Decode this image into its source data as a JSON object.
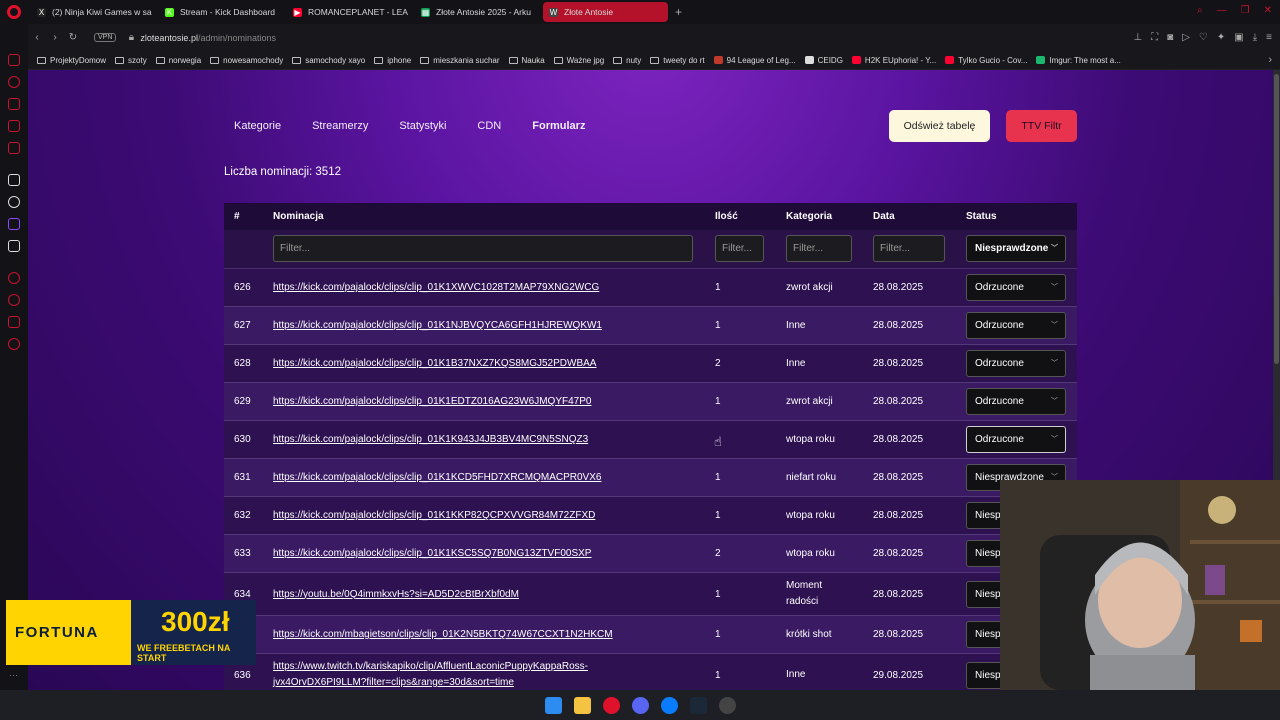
{
  "browser": {
    "tabs": [
      {
        "title": "(2) Ninja Kiwi Games w sa",
        "color": "#222222",
        "glyph": "X"
      },
      {
        "title": "Stream - Kick Dashboard",
        "color": "#53fc18",
        "glyph": "K"
      },
      {
        "title": "ROMANCEPLANET - LEA",
        "color": "#ff0033",
        "glyph": "▶"
      },
      {
        "title": "Złote Antosie 2025 - Arku",
        "color": "#0f9d58",
        "glyph": "▦"
      },
      {
        "title": "Złote Antosie",
        "color": "#444444",
        "glyph": "W"
      }
    ],
    "url_host": "zloteantosie.pl",
    "url_path": "/admin/nominations",
    "vpn_label": "VPN",
    "bookmarks": [
      {
        "label": "ProjektyDomow",
        "type": "folder"
      },
      {
        "label": "szoty",
        "type": "folder"
      },
      {
        "label": "norwegia",
        "type": "folder"
      },
      {
        "label": "nowesamochody",
        "type": "folder"
      },
      {
        "label": "samochody xayo",
        "type": "folder"
      },
      {
        "label": "iphone",
        "type": "folder"
      },
      {
        "label": "mieszkania suchar",
        "type": "folder"
      },
      {
        "label": "Nauka",
        "type": "folder"
      },
      {
        "label": "Ważne jpg",
        "type": "folder"
      },
      {
        "label": "nuty",
        "type": "folder"
      },
      {
        "label": "tweety do rt",
        "type": "folder"
      },
      {
        "label": "94 League of Leg...",
        "type": "site",
        "color": "#c0392b"
      },
      {
        "label": "CEIDG",
        "type": "site",
        "color": "#dddddd"
      },
      {
        "label": "H2K EUphoria! - Y...",
        "type": "site",
        "color": "#ff0033"
      },
      {
        "label": "Tylko Gucio - Cov...",
        "type": "site",
        "color": "#ff0033"
      },
      {
        "label": "Imgur: The most a...",
        "type": "site",
        "color": "#1bb76e"
      }
    ]
  },
  "nav": {
    "links": [
      "Kategorie",
      "Streamerzy",
      "Statystyki",
      "CDN",
      "Formularz"
    ],
    "active": "Formularz",
    "refresh_label": "Odśwież tabelę",
    "ttv_label": "TTV Filtr"
  },
  "summary": {
    "count_text": "Liczba nominacji: 3512"
  },
  "table": {
    "headers": {
      "num": "#",
      "nomination": "Nominacja",
      "qty": "Ilość",
      "category": "Kategoria",
      "date": "Data",
      "status": "Status"
    },
    "filter_placeholder": "Filter...",
    "status_filter": "Niesprawdzone",
    "rows": [
      {
        "id": "626",
        "link": "https://kick.com/pajalock/clips/clip_01K1XWVC1028T2MAP79XNG2WCG",
        "qty": "1",
        "category": "zwrot akcji",
        "date": "28.08.2025",
        "status": "Odrzucone"
      },
      {
        "id": "627",
        "link": "https://kick.com/pajalock/clips/clip_01K1NJBVQYCA6GFH1HJREWQKW1",
        "qty": "1",
        "category": "Inne",
        "date": "28.08.2025",
        "status": "Odrzucone"
      },
      {
        "id": "628",
        "link": "https://kick.com/pajalock/clips/clip_01K1B37NXZ7KQS8MGJ52PDWBAA",
        "qty": "2",
        "category": "Inne",
        "date": "28.08.2025",
        "status": "Odrzucone"
      },
      {
        "id": "629",
        "link": "https://kick.com/pajalock/clips/clip_01K1EDTZ016AG23W6JMQYF47P0",
        "qty": "1",
        "category": "zwrot akcji",
        "date": "28.08.2025",
        "status": "Odrzucone"
      },
      {
        "id": "630",
        "link": "https://kick.com/pajalock/clips/clip_01K1K943J4JB3BV4MC9N5SNQZ3",
        "qty": "",
        "category": "wtopa roku",
        "date": "28.08.2025",
        "status": "Odrzucone"
      },
      {
        "id": "631",
        "link": "https://kick.com/pajalock/clips/clip_01K1KCD5FHD7XRCMQMACPR0VX6",
        "qty": "1",
        "category": "niefart roku",
        "date": "28.08.2025",
        "status": "Niesprawdzone"
      },
      {
        "id": "632",
        "link": "https://kick.com/pajalock/clips/clip_01K1KKP82QCPXVVGR84M72ZFXD",
        "qty": "1",
        "category": "wtopa roku",
        "date": "28.08.2025",
        "status": "Niesp"
      },
      {
        "id": "633",
        "link": "https://kick.com/pajalock/clips/clip_01K1KSC5SQ7B0NG13ZTVF00SXP",
        "qty": "2",
        "category": "wtopa roku",
        "date": "28.08.2025",
        "status": "Niesp"
      },
      {
        "id": "634",
        "link": "https://youtu.be/0Q4immkxvHs?si=AD5D2cBtBrXbf0dM",
        "qty": "1",
        "category": "Moment radości",
        "date": "28.08.2025",
        "status": "Niesp"
      },
      {
        "id": "",
        "link": "https://kick.com/mbagietson/clips/clip_01K2N5BKTQ74W67CCXT1N2HKCM",
        "qty": "1",
        "category": "krótki shot",
        "date": "28.08.2025",
        "status": "Niesp"
      },
      {
        "id": "636",
        "link": "https://www.twitch.tv/kariskapiko/clip/AffluentLaconicPuppyKappaRoss-jvx4OrvDX6PI9LLM?filter=clips&range=30d&sort=time",
        "qty": "1",
        "category": "Inne",
        "date": "29.08.2025",
        "status": "Niesp"
      }
    ]
  },
  "ad": {
    "brand": "FORTUNA",
    "amount": "300zł",
    "tagline": "WE FREEBETACH NA START"
  }
}
